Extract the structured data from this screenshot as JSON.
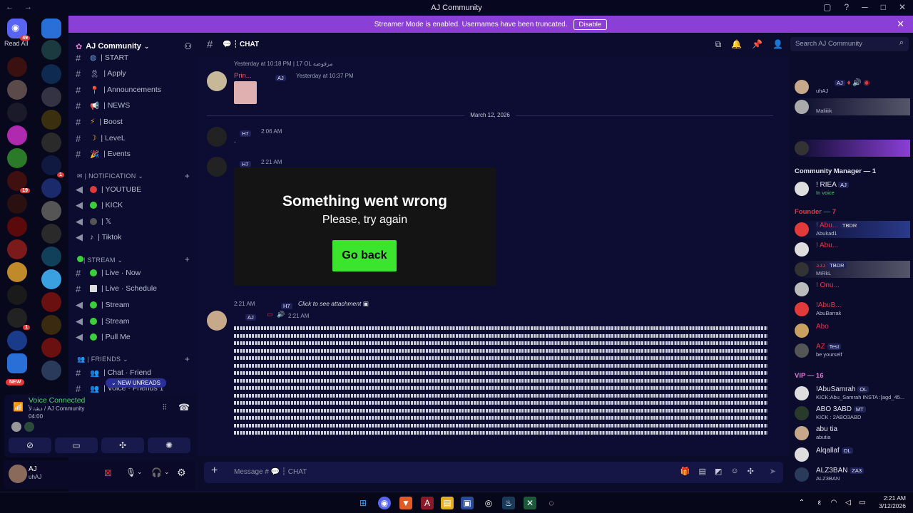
{
  "titlebar": {
    "nav": "← →",
    "title": "AJ Community",
    "ctrls": [
      "▢",
      "?",
      "─",
      "□",
      "✕"
    ]
  },
  "rail": {
    "read_all": "Read All",
    "home_badge": "49",
    "badges": {
      "b1": "19",
      "b2": "1",
      "b3": "1",
      "b4": "1"
    },
    "new_label": "NEW"
  },
  "streamer": {
    "text": "Streamer Mode is enabled. Usernames have been truncated.",
    "disable": "Disable"
  },
  "server": {
    "name": "AJ Community"
  },
  "channels": {
    "start": "| START",
    "apply": "| Apply",
    "announcements": "| Announcements",
    "news": "| NEWS",
    "boost": "| Boost",
    "level": "| LeveL",
    "events": "| Events",
    "cat_notification": "| NOTIFICATION",
    "youtube": "| YOUTUBE",
    "kick": "| KICK",
    "x": "| 𝕏",
    "tiktok": "| Tiktok",
    "cat_stream": "| STREAM",
    "live_now": "| Live · Now",
    "live_schedule": "| Live · Schedule",
    "stream1": "| Stream",
    "stream2": "| Stream",
    "pullme": "| Pull Me",
    "cat_friends": "| FRIENDS",
    "chat_friend": "| Chat · Friend",
    "voice_friends": "| Voice · Friends 1"
  },
  "new_unreads": "NEW UNREADS",
  "voice": {
    "status": "Voice Connected",
    "channel": "ﺩﺸﺗ ﻷ / AJ Community",
    "time": "04:00"
  },
  "user": {
    "name": "AJ",
    "status": "uhAJ"
  },
  "chat": {
    "name": "CHAT",
    "search_placeholder": "Search AJ Community"
  },
  "messages": {
    "reply1": "Yesterday at 10:18 PM | 17  OL  مرفوضه",
    "reply1_user": "Prin...",
    "reply1_tag": "AJ",
    "reply1_time": "Yesterday at 10:37 PM",
    "date_divider": "March 12, 2026",
    "m2_tag": "H7",
    "m2_time": "2:06 AM",
    "m2_text": ".",
    "m3_tag": "H7",
    "m3_time": "2:21 AM",
    "error_title": "Something went wrong",
    "error_sub": "Please, try again",
    "error_button": "Go back",
    "reply2_time": "2:21 AM",
    "reply2_tag": "H7",
    "reply2_text": "Click to see attachment",
    "m4_tag": "AJ",
    "m4_time": "2:21 AM",
    "spam_char": "«"
  },
  "composer": {
    "placeholder": "Message # 💬 ┆ CHAT"
  },
  "members": {
    "m1": {
      "tag": "AJ",
      "sub": "uhAJ"
    },
    "m2": {
      "sub": "Maliiiik"
    },
    "cat_cm": "Community Manager — 1",
    "m4": {
      "name": "! RIEA",
      "tag": "AJ",
      "sub": "In voice"
    },
    "cat_founder": "Founder — 7",
    "m5": {
      "name": "! Abu...",
      "tag": "TBDR",
      "sub": "Abukad1"
    },
    "m6": {
      "name": "! Abu..."
    },
    "m7": {
      "name": "ﺩﺩﺩ",
      "tag": "TBDR",
      "sub": "MiRkL"
    },
    "m8": {
      "name": "! Onu..."
    },
    "m9": {
      "name": "!AbuB...",
      "sub": "AbuBarrak"
    },
    "m10": {
      "name": "Abo"
    },
    "m11": {
      "name": "AZ",
      "tag": "Test",
      "sub": "be yourself"
    },
    "cat_vip": "VIP — 16",
    "v1": {
      "name": "!AbuSamrah",
      "tag": "OL",
      "sub": "KICK:Abu_Samrah INSTA :[agd_45..."
    },
    "v2": {
      "name": "ABO 3ABD",
      "tag": "MT",
      "sub": "KICK : 2ABO3ABD"
    },
    "v3": {
      "name": "abu tia",
      "sub": "abutia"
    },
    "v4": {
      "name": "Alqallaf",
      "tag": "OL"
    },
    "v5": {
      "name": "ALZ3BAN",
      "tag": "ZA3",
      "sub": "ALZ3BAN"
    }
  },
  "taskbar": {
    "time": "2:21 AM",
    "date": "3/12/2026"
  },
  "colors": {
    "accent": "#8a3fd6",
    "online": "#23a55a",
    "error_button": "#3be52e",
    "founder": "#e0384a"
  }
}
